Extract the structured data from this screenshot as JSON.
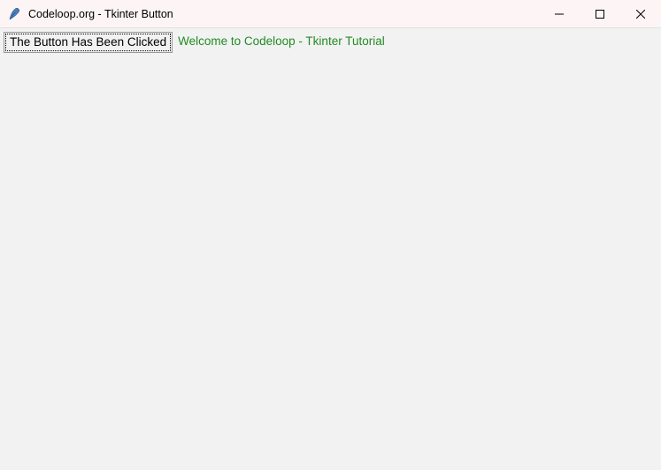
{
  "window": {
    "title": "Codeloop.org - Tkinter Button"
  },
  "content": {
    "button_label": "The Button Has Been Clicked",
    "label_text": "Welcome to Codeloop - Tkinter Tutorial"
  }
}
